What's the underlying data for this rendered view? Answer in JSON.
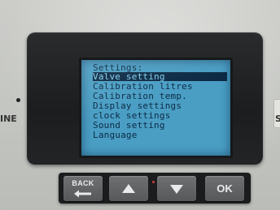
{
  "device": {
    "left_label": "INE",
    "right_label": "S"
  },
  "screen": {
    "menu_title": "Settings:",
    "menu_items": [
      {
        "label": "Valve setting",
        "selected": true
      },
      {
        "label": "Calibration litres",
        "selected": false
      },
      {
        "label": "Calibration temp.",
        "selected": false
      },
      {
        "label": "Display settings",
        "selected": false
      },
      {
        "label": "clock settings",
        "selected": false
      },
      {
        "label": "Sound setting",
        "selected": false
      },
      {
        "label": "Language",
        "selected": false
      }
    ],
    "colors": {
      "lcd_background": "#4a9ec4",
      "lcd_text": "#0c2a44",
      "highlight_text": "#7fd0f0"
    }
  },
  "buttons": {
    "back_label": "BACK",
    "back_icon": "left-arrow-icon",
    "up_icon": "up-triangle-icon",
    "down_icon": "down-triangle-icon",
    "ok_label": "OK"
  }
}
